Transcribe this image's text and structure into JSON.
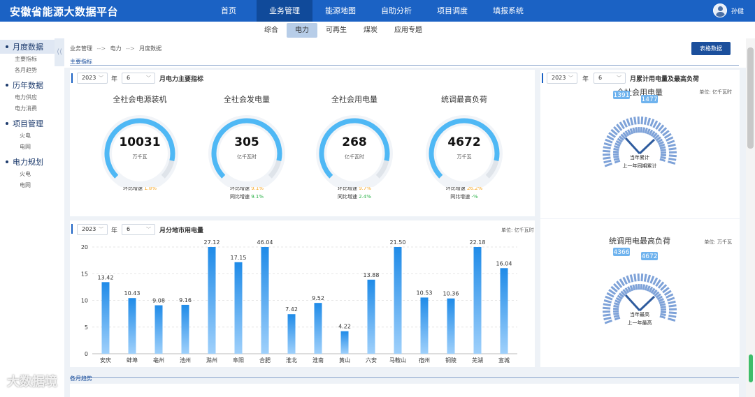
{
  "app": {
    "title": "安徽省能源大数据平台"
  },
  "nav": [
    "首页",
    "业务管理",
    "能源地图",
    "自助分析",
    "项目调度",
    "填报系统"
  ],
  "user": {
    "name": "孙健"
  },
  "subtabs": [
    "综合",
    "电力",
    "可再生",
    "煤炭",
    "应用专题"
  ],
  "sidebar": {
    "groups": [
      {
        "label": "月度数据",
        "items": [
          "主要指标",
          "各月趋势"
        ]
      },
      {
        "label": "历年数据",
        "items": [
          "电力供应",
          "电力消费"
        ]
      },
      {
        "label": "项目管理",
        "items": [
          "火电",
          "电网"
        ]
      },
      {
        "label": "电力规划",
        "items": [
          "火电",
          "电网"
        ]
      }
    ],
    "collapse": "⟨⟨"
  },
  "breadcrumb": {
    "a": "业务管理",
    "sep": "-->",
    "b": "电力",
    "c": "月度数据"
  },
  "button_table": "表格数据",
  "section_main": "主要指标",
  "section_bottom": "各月趋势",
  "kpi_panel": {
    "year": "2023",
    "year_suffix": "年",
    "month": "6",
    "title": "月电力主要指标",
    "rate_hb": "环比增速",
    "rate_tb": "同比增速",
    "items": [
      {
        "title": "全社会电源装机",
        "value": "10031",
        "unit": "万千瓦",
        "hb": "1.8%",
        "tb": ""
      },
      {
        "title": "全社会发电量",
        "value": "305",
        "unit": "亿千瓦时",
        "hb": "9.1%",
        "tb": "9.1%"
      },
      {
        "title": "全社会用电量",
        "value": "268",
        "unit": "亿千瓦时",
        "hb": "9.7%",
        "tb": "2.4%"
      },
      {
        "title": "统调最高负荷",
        "value": "4672",
        "unit": "万千瓦",
        "hb": "26.2%",
        "tb": "-%"
      }
    ]
  },
  "cumulative_panel": {
    "year": "2023",
    "year_suffix": "年",
    "month": "6",
    "title": "月累计用电量及最高负荷",
    "top": {
      "title": "全社会用电量",
      "unit": "单位: 亿千瓦时",
      "a": "1391",
      "b": "1477",
      "l1": "当年累计",
      "l2": "上一年同期累计"
    },
    "bottom": {
      "title": "统调用电最高负荷",
      "unit": "单位: 万千瓦",
      "a": "4366",
      "b": "4672",
      "l1": "当年最高",
      "l2": "上一年最高"
    }
  },
  "city_panel": {
    "year": "2023",
    "year_suffix": "年",
    "month": "6",
    "title": "月分地市用电量",
    "unit": "单位: 亿千瓦时"
  },
  "chart_data": {
    "type": "bar",
    "categories": [
      "安庆",
      "蚌埠",
      "亳州",
      "池州",
      "滁州",
      "阜阳",
      "合肥",
      "淮北",
      "淮南",
      "黄山",
      "六安",
      "马鞍山",
      "宿州",
      "铜陵",
      "芜湖",
      "宣城"
    ],
    "values": [
      13.42,
      10.43,
      9.08,
      9.16,
      27.12,
      17.15,
      46.04,
      7.42,
      9.52,
      4.22,
      13.88,
      21.5,
      10.53,
      10.36,
      22.18,
      16.04
    ],
    "value_labels": [
      "13.42",
      "10.43",
      "9.08",
      "9.16",
      "27.12",
      "17.15",
      "46.04",
      "7.42",
      "9.52",
      "4.22",
      "13.88",
      "21.50",
      "10.53",
      "10.36",
      "22.18",
      "16.04"
    ],
    "ylim": [
      0,
      20
    ],
    "yticks": [
      0,
      5,
      10,
      15,
      20
    ],
    "grid": true,
    "colors": [
      "#1f8be8",
      "#9fd0fb"
    ]
  },
  "watermark": "大数据境"
}
